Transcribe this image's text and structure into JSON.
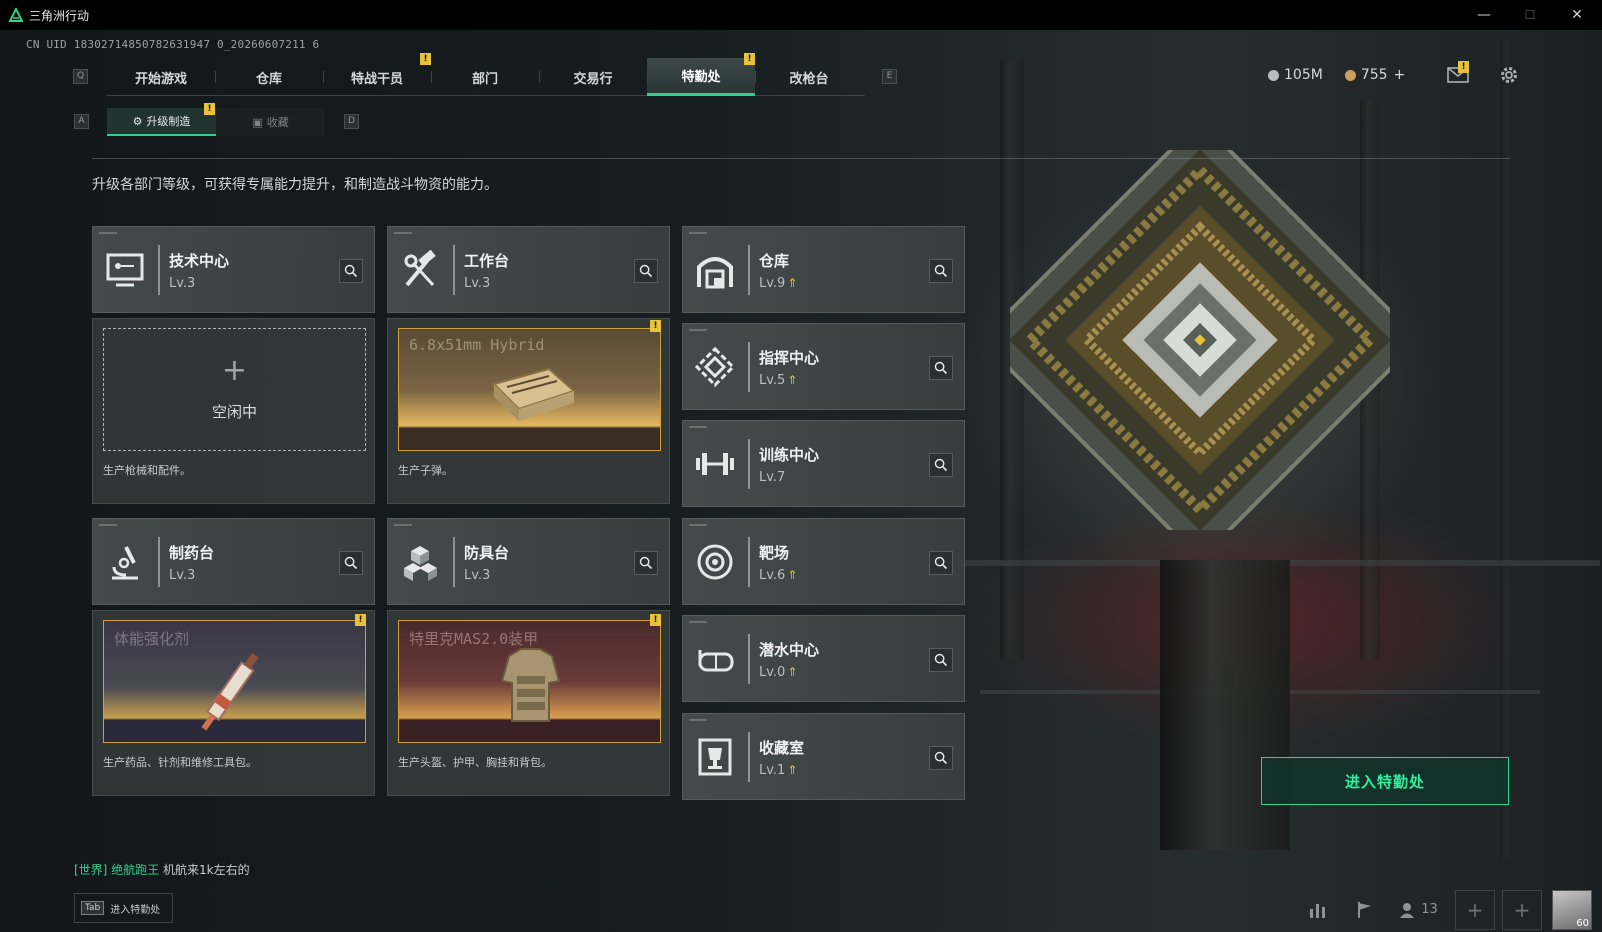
{
  "window": {
    "title": "三角洲行动",
    "minimize": "—",
    "maximize": "☐",
    "close": "✕"
  },
  "uid": "CN UID 18302714850782631947 0_20260607211 6",
  "nav": {
    "left_key": "Q",
    "right_key": "E",
    "tabs": [
      {
        "label": "开始游戏"
      },
      {
        "label": "仓库"
      },
      {
        "label": "特战干员"
      },
      {
        "label": "部门"
      },
      {
        "label": "交易行"
      },
      {
        "label": "特勤处"
      },
      {
        "label": "改枪台"
      }
    ],
    "active": "特勤处"
  },
  "status": {
    "currency1": "105M",
    "currency2": "755",
    "plus": "+"
  },
  "subtabs": {
    "left_key": "A",
    "right_key": "D",
    "items": [
      {
        "label": "升级制造"
      },
      {
        "label": "收藏"
      }
    ]
  },
  "description": "升级各部门等级，可获得专属能力提升，和制造战斗物资的能力。",
  "departments": [
    {
      "name": "技术中心",
      "level": "Lv.3",
      "icon": "computer-icon",
      "upgradable": false
    },
    {
      "name": "工作台",
      "level": "Lv.3",
      "icon": "tools-icon",
      "upgradable": false
    },
    {
      "name": "仓库",
      "level": "Lv.9",
      "icon": "warehouse-icon",
      "upgradable": true
    },
    {
      "name": "指挥中心",
      "level": "Lv.5",
      "icon": "command-icon",
      "upgradable": true
    },
    {
      "name": "训练中心",
      "level": "Lv.7",
      "icon": "dumbbell-icon",
      "upgradable": false
    },
    {
      "name": "制药台",
      "level": "Lv.3",
      "icon": "microscope-icon",
      "upgradable": false
    },
    {
      "name": "防具台",
      "level": "Lv.3",
      "icon": "cubes-icon",
      "upgradable": false
    },
    {
      "name": "靶场",
      "level": "Lv.6",
      "icon": "target-icon",
      "upgradable": true
    },
    {
      "name": "潜水中心",
      "level": "Lv.0",
      "icon": "goggles-icon",
      "upgradable": true
    },
    {
      "name": "收藏室",
      "level": "Lv.1",
      "icon": "trophy-icon",
      "upgradable": true
    }
  ],
  "production": [
    {
      "item": "",
      "idle_label": "空闲中",
      "idle_plus": "+",
      "caption": "生产枪械和配件。"
    },
    {
      "item": "6.8x51mm Hybrid",
      "caption": "生产子弹。"
    },
    {
      "item": "体能强化剂",
      "caption": "生产药品、针剂和维修工具包。"
    },
    {
      "item": "特里克MAS2.0装甲",
      "caption": "生产头盔、护甲、胸挂和背包。"
    }
  ],
  "alert_mark": "!",
  "enter_button": "进入特勤处",
  "chat": {
    "channel": "[世界]",
    "user": "绝航跑王",
    "message": "机航来1k左右的"
  },
  "tab_hint": {
    "key": "Tab",
    "label": "进入特勤处"
  },
  "bottom": {
    "friends_count": "13",
    "add1": "+",
    "add2": "+",
    "avatar_level": "60"
  },
  "colors": {
    "accent": "#2ed18f",
    "alert": "#e8c23a",
    "card": "#4a5050"
  }
}
